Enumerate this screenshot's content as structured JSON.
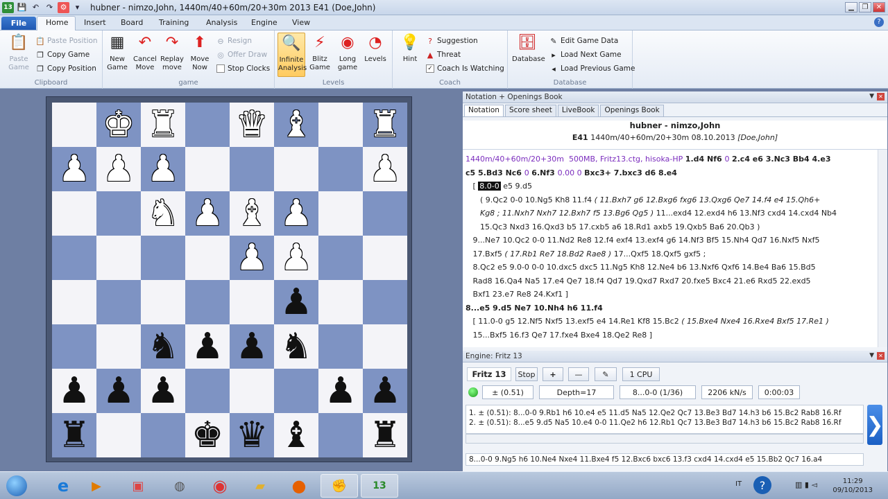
{
  "app": {
    "title": "hubner - nimzo,John, 1440m/40+60m/20+30m 2013  E41  (Doe,John)",
    "badge": "13"
  },
  "ribbon_tabs": [
    "File",
    "Home",
    "Insert",
    "Board",
    "Training",
    "Analysis",
    "Engine",
    "View"
  ],
  "groups": {
    "clipboard": "Clipboard",
    "game": "game",
    "levels": "Levels",
    "coach": "Coach",
    "database": "Database"
  },
  "buttons": {
    "paste_game": "Paste Game",
    "paste_position": "Paste Position",
    "copy_game": "Copy Game",
    "copy_position": "Copy Position",
    "new_game": "New Game",
    "cancel_move": "Cancel Move",
    "replay_move": "Replay move",
    "move_now": "Move Now",
    "resign": "Resign",
    "offer_draw": "Offer Draw",
    "stop_clocks": "Stop Clocks",
    "infinite_analysis": "Infinite Analysis",
    "blitz_game": "Blitz Game",
    "long_game": "Long game",
    "levels": "Levels",
    "hint": "Hint",
    "suggestion": "Suggestion",
    "threat": "Threat",
    "coach_watching": "Coach Is Watching",
    "database": "Database",
    "edit_game_data": "Edit Game Data",
    "load_next_game": "Load Next Game",
    "load_previous_game": "Load Previous Game"
  },
  "board": [
    [
      "",
      "wK",
      "wR",
      "",
      "wQ",
      "wB",
      "",
      "wR"
    ],
    [
      "wP",
      "wP",
      "wP",
      "",
      "",
      "",
      "",
      "wP"
    ],
    [
      "",
      "",
      "wN",
      "wP",
      "wB",
      "wP",
      "",
      ""
    ],
    [
      "",
      "",
      "",
      "",
      "wP",
      "wP",
      "",
      ""
    ],
    [
      "",
      "",
      "",
      "",
      "",
      "bP",
      "",
      ""
    ],
    [
      "",
      "",
      "bN",
      "bP",
      "bP",
      "bN",
      "",
      ""
    ],
    [
      "bP",
      "bP",
      "bP",
      "",
      "",
      "",
      "bP",
      "bP"
    ],
    [
      "bR",
      "",
      "",
      "bK",
      "bQ",
      "bB",
      "",
      "bR"
    ]
  ],
  "notation": {
    "panel_title": "Notation + Openings Book",
    "tabs": [
      "Notation",
      "Score sheet",
      "LiveBook",
      "Openings Book"
    ],
    "players": "hubner - nimzo,John",
    "eco": "E41",
    "event_info": "1440m/40+60m/20+30m 08.10.2013",
    "annotator": "[Doe,John]",
    "lines": [
      [
        {
          "t": "1440m/40+60m/20+30m  500MB, Fritz13.ctg, hisoka-HP ",
          "c": "ev"
        },
        {
          "t": "1.d4 Nf6 ",
          "c": "mv"
        },
        {
          "t": "0 ",
          "c": "ev"
        },
        {
          "t": "2.c4 e6 3.Nc3 Bb4 4.e3",
          "c": "mv"
        }
      ],
      [
        {
          "t": "c5 5.Bd3 Nc6 ",
          "c": "mv"
        },
        {
          "t": "0 ",
          "c": "ev"
        },
        {
          "t": "6.Nf3 ",
          "c": "mv"
        },
        {
          "t": "0.00 0 ",
          "c": "ev"
        },
        {
          "t": "Bxc3+ 7.bxc3 d6 8.e4",
          "c": "mv"
        }
      ],
      [
        {
          "t": "   [ ",
          "c": ""
        },
        {
          "t": "8.0-0",
          "c": "sel"
        },
        {
          "t": " e5 9.d5",
          "c": ""
        }
      ],
      [
        {
          "t": "      ( 9.Qc2 0-0 10.Ng5 Kh8 11.f4 ",
          "c": ""
        },
        {
          "t": "( 11.Bxh7 g6 12.Bxg6 fxg6 13.Qxg6 Qe7 14.f4 e4 15.Qh6+",
          "c": "cm"
        }
      ],
      [
        {
          "t": "      Kg8 ; 11.Nxh7 Nxh7 12.Bxh7 f5 13.Bg6 Qg5 ) ",
          "c": "cm"
        },
        {
          "t": "11...exd4 12.exd4 h6 13.Nf3 cxd4 14.cxd4 Nb4",
          "c": ""
        }
      ],
      [
        {
          "t": "      15.Qc3 Nxd3 16.Qxd3 b5 17.cxb5 a6 18.Rd1 axb5 19.Qxb5 Ba6 20.Qb3 )",
          "c": ""
        }
      ],
      [
        {
          "t": "   9...Ne7 10.Qc2 0-0 11.Nd2 Re8 12.f4 exf4 13.exf4 g6 14.Nf3 Bf5 15.Nh4 Qd7 16.Nxf5 Nxf5",
          "c": ""
        }
      ],
      [
        {
          "t": "   17.Bxf5 ",
          "c": ""
        },
        {
          "t": "( 17.Rb1 Re7 18.Bd2 Rae8 ) ",
          "c": "cm"
        },
        {
          "t": "17...Qxf5 18.Qxf5 gxf5 ;",
          "c": ""
        }
      ],
      [
        {
          "t": "   8.Qc2 e5 9.0-0 0-0 10.dxc5 dxc5 11.Ng5 Kh8 12.Ne4 b6 13.Nxf6 Qxf6 14.Be4 Ba6 15.Bd5",
          "c": ""
        }
      ],
      [
        {
          "t": "   Rad8 16.Qa4 Na5 17.e4 Qe7 18.f4 Qd7 19.Qxd7 Rxd7 20.fxe5 Bxc4 21.e6 Rxd5 22.exd5",
          "c": ""
        }
      ],
      [
        {
          "t": "   Bxf1 23.e7 Re8 24.Kxf1 ]",
          "c": ""
        }
      ],
      [
        {
          "t": "8...e5 9.d5 Ne7 10.Nh4 h6 11.f4",
          "c": "mv"
        }
      ],
      [
        {
          "t": "   [ 11.0-0 g5 12.Nf5 Nxf5 13.exf5 e4 14.Re1 Kf8 15.Bc2 ",
          "c": ""
        },
        {
          "t": "( 15.Bxe4 Nxe4 16.Rxe4 Bxf5 17.Re1 )",
          "c": "cm"
        }
      ],
      [
        {
          "t": "   15...Bxf5 16.f3 Qe7 17.fxe4 Bxe4 18.Qe2 Re8 ]",
          "c": ""
        }
      ]
    ]
  },
  "engine": {
    "panel_title": "Engine: Fritz 13",
    "name": "Fritz 13",
    "stop": "Stop",
    "plus": "+",
    "minus": "—",
    "cpu": "1 CPU",
    "eval": "±  (0.51)",
    "depth": "Depth=17",
    "move": "8...0-0 (1/36)",
    "speed": "2206 kN/s",
    "time": "0:00:03",
    "lines": [
      "1. ±  (0.51): 8...0-0 9.Rb1 h6 10.e4 e5 11.d5 Na5 12.Qe2 Qc7 13.Be3 Bd7 14.h3 b6 15.Bc2 Rab8 16.Rf",
      "2. ±  (0.51): 8...e5 9.d5 Na5 10.e4 0-0 11.Qe2 h6 12.Rb1 Qc7 13.Be3 Bd7 14.h3 b6 15.Bc2 Rab8 16.Rf"
    ],
    "bottom_line": "8...0-0 9.Ng5 h6 10.Ne4 Nxe4 11.Bxe4 f5 12.Bxc6 bxc6 13.f3 cxd4 14.cxd4 e5 15.Bb2 Qc7 16.a4"
  },
  "taskbar": {
    "lang": "IT",
    "time": "11:29",
    "date": "09/10/2013"
  }
}
